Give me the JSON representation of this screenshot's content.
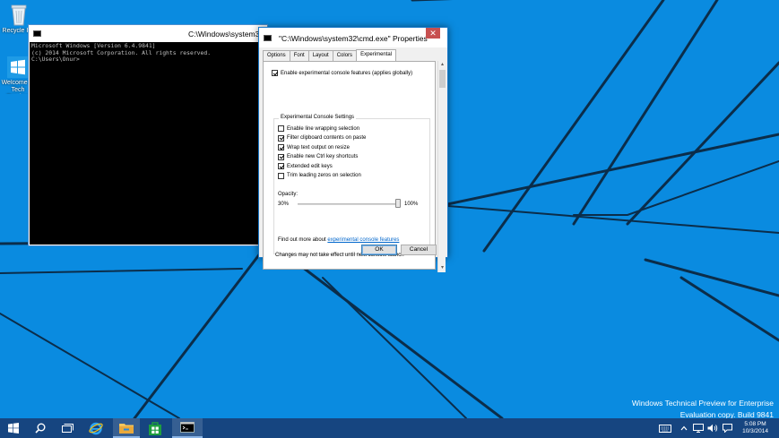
{
  "desktop": {
    "icons": [
      {
        "label": "Recycle Bin",
        "icon": "recycle-bin-icon"
      },
      {
        "label": "Welcome to Tech Preview",
        "icon": "windows-logo-icon"
      }
    ],
    "watermark": {
      "line1": "Windows Technical Preview for Enterprise",
      "line2": "Evaluation copy. Build 9841"
    },
    "colors": {
      "background": "#0a8be0",
      "lines": "#0b2d4a",
      "taskbar": "#164580"
    }
  },
  "console": {
    "title": "C:\\Windows\\system32",
    "lines": [
      "Microsoft Windows [Version 6.4.9841]",
      "(c) 2014 Microsoft Corporation. All rights reserved.",
      "",
      "C:\\Users\\Onur>"
    ]
  },
  "properties": {
    "title": "\"C:\\Windows\\system32\\cmd.exe\" Properties",
    "close_label": "✕",
    "tabs": [
      {
        "label": "Options",
        "active": false
      },
      {
        "label": "Font",
        "active": false
      },
      {
        "label": "Layout",
        "active": false
      },
      {
        "label": "Colors",
        "active": false
      },
      {
        "label": "Experimental",
        "active": true
      }
    ],
    "enable_all": {
      "label": "Enable experimental console features (applies globally)",
      "checked": true
    },
    "group_title": "Experimental Console Settings",
    "options": [
      {
        "label": "Enable line wrapping selection",
        "checked": false
      },
      {
        "label": "Filter clipboard contents on paste",
        "checked": true
      },
      {
        "label": "Wrap text output on resize",
        "checked": true
      },
      {
        "label": "Enable new Ctrl key shortcuts",
        "checked": true
      },
      {
        "label": "Extended edit keys",
        "checked": true
      },
      {
        "label": "Trim leading zeros on selection",
        "checked": false
      }
    ],
    "opacity": {
      "label": "Opacity:",
      "min_label": "30%",
      "max_label": "100%",
      "value_percent": 100
    },
    "find_more_text": "Find out more about",
    "find_more_link": "experimental console features",
    "footer_note": "Changes may not take effect until next console launch",
    "ok_label": "OK",
    "cancel_label": "Cancel"
  },
  "taskbar": {
    "buttons": [
      {
        "name": "start",
        "icon": "windows-logo-icon"
      },
      {
        "name": "search",
        "icon": "search-icon"
      },
      {
        "name": "task-view",
        "icon": "task-view-icon"
      },
      {
        "name": "internet-explorer",
        "icon": "ie-icon"
      },
      {
        "name": "file-explorer",
        "icon": "folder-icon"
      },
      {
        "name": "store",
        "icon": "store-icon"
      },
      {
        "name": "command-prompt",
        "icon": "cmd-icon"
      }
    ],
    "tray": [
      "keyboard-icon",
      "chevron-up-icon",
      "network-icon",
      "volume-icon",
      "action-center-icon"
    ],
    "time": "5:08 PM",
    "date": "10/3/2014"
  }
}
